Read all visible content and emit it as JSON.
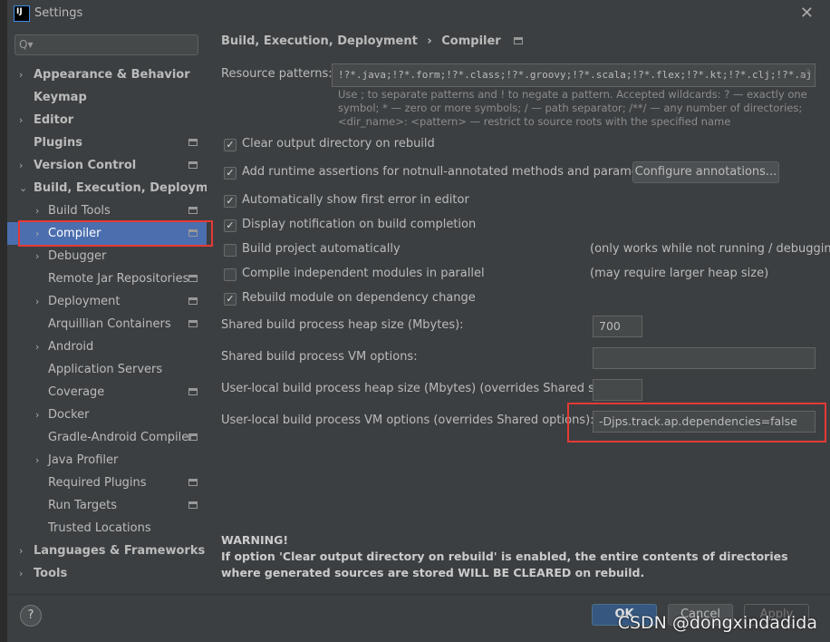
{
  "window": {
    "title": "Settings",
    "logo": "IJ",
    "close": "✕"
  },
  "search": {
    "icon": "search-icon",
    "placeholder": "Q▾"
  },
  "tree": [
    {
      "label": "Appearance & Behavior",
      "level": 0,
      "arrow": "›",
      "bold": true
    },
    {
      "label": "Keymap",
      "level": 0,
      "arrow": "",
      "bold": true
    },
    {
      "label": "Editor",
      "level": 0,
      "arrow": "›",
      "bold": true
    },
    {
      "label": "Plugins",
      "level": 0,
      "arrow": "",
      "bold": true,
      "proj": true
    },
    {
      "label": "Version Control",
      "level": 0,
      "arrow": "›",
      "bold": true,
      "proj": true
    },
    {
      "label": "Build, Execution, Deployment",
      "level": 0,
      "arrow": "⌄",
      "bold": true
    },
    {
      "label": "Build Tools",
      "level": 1,
      "arrow": "›",
      "proj": true
    },
    {
      "label": "Compiler",
      "level": 1,
      "arrow": "›",
      "proj": true,
      "selected": true
    },
    {
      "label": "Debugger",
      "level": 1,
      "arrow": "›"
    },
    {
      "label": "Remote Jar Repositories",
      "level": 1,
      "arrow": "",
      "proj": true
    },
    {
      "label": "Deployment",
      "level": 1,
      "arrow": "›",
      "proj": true
    },
    {
      "label": "Arquillian Containers",
      "level": 1,
      "arrow": "",
      "proj": true
    },
    {
      "label": "Android",
      "level": 1,
      "arrow": "›"
    },
    {
      "label": "Application Servers",
      "level": 1,
      "arrow": ""
    },
    {
      "label": "Coverage",
      "level": 1,
      "arrow": "",
      "proj": true
    },
    {
      "label": "Docker",
      "level": 1,
      "arrow": "›"
    },
    {
      "label": "Gradle-Android Compiler",
      "level": 1,
      "arrow": "",
      "proj": true
    },
    {
      "label": "Java Profiler",
      "level": 1,
      "arrow": "›"
    },
    {
      "label": "Required Plugins",
      "level": 1,
      "arrow": "",
      "proj": true
    },
    {
      "label": "Run Targets",
      "level": 1,
      "arrow": "",
      "proj": true
    },
    {
      "label": "Trusted Locations",
      "level": 1,
      "arrow": ""
    },
    {
      "label": "Languages & Frameworks",
      "level": 0,
      "arrow": "›",
      "bold": true
    },
    {
      "label": "Tools",
      "level": 0,
      "arrow": "›",
      "bold": true
    }
  ],
  "breadcrumb": {
    "parent": "Build, Execution, Deployment",
    "sep": "›",
    "current": "Compiler"
  },
  "resource": {
    "label": "Resource patterns:",
    "value": "!?*.java;!?*.form;!?*.class;!?*.groovy;!?*.scala;!?*.flex;!?*.kt;!?*.clj;!?*.aj",
    "hint": "Use ; to separate patterns and ! to negate a pattern. Accepted wildcards: ? — exactly one symbol; * — zero or more symbols; / — path separator; /**/ — any number of directories; <dir_name>: <pattern> — restrict to source roots with the specified name"
  },
  "options": [
    {
      "label": "Clear output directory on rebuild",
      "checked": true
    },
    {
      "label": "Add runtime assertions for notnull-annotated methods and parameters",
      "checked": true
    },
    {
      "label": "Automatically show first error in editor",
      "checked": true
    },
    {
      "label": "Display notification on build completion",
      "checked": true
    },
    {
      "label": "Build project automatically",
      "checked": false,
      "note": "(only works while not running / debugging)"
    },
    {
      "label": "Compile independent modules in parallel",
      "checked": false,
      "note": "(may require larger heap size)"
    },
    {
      "label": "Rebuild module on dependency change",
      "checked": true
    }
  ],
  "configure_button": "Configure annotations...",
  "fields": [
    {
      "label": "Shared build process heap size (Mbytes):",
      "value": "700"
    },
    {
      "label": "Shared build process VM options:",
      "value": ""
    },
    {
      "label": "User-local build process heap size (Mbytes) (overrides Shared size):",
      "value": ""
    },
    {
      "label": "User-local build process VM options (overrides Shared options):",
      "value": "-Djps.track.ap.dependencies=false"
    }
  ],
  "warning": {
    "title": "WARNING!",
    "text": "If option 'Clear output directory on rebuild' is enabled, the entire contents of directories where generated sources are stored WILL BE CLEARED on rebuild."
  },
  "footer": {
    "help": "?",
    "ok": "OK",
    "cancel": "Cancel",
    "apply": "Apply",
    "watermark": "CSDN @dongxindadida"
  }
}
